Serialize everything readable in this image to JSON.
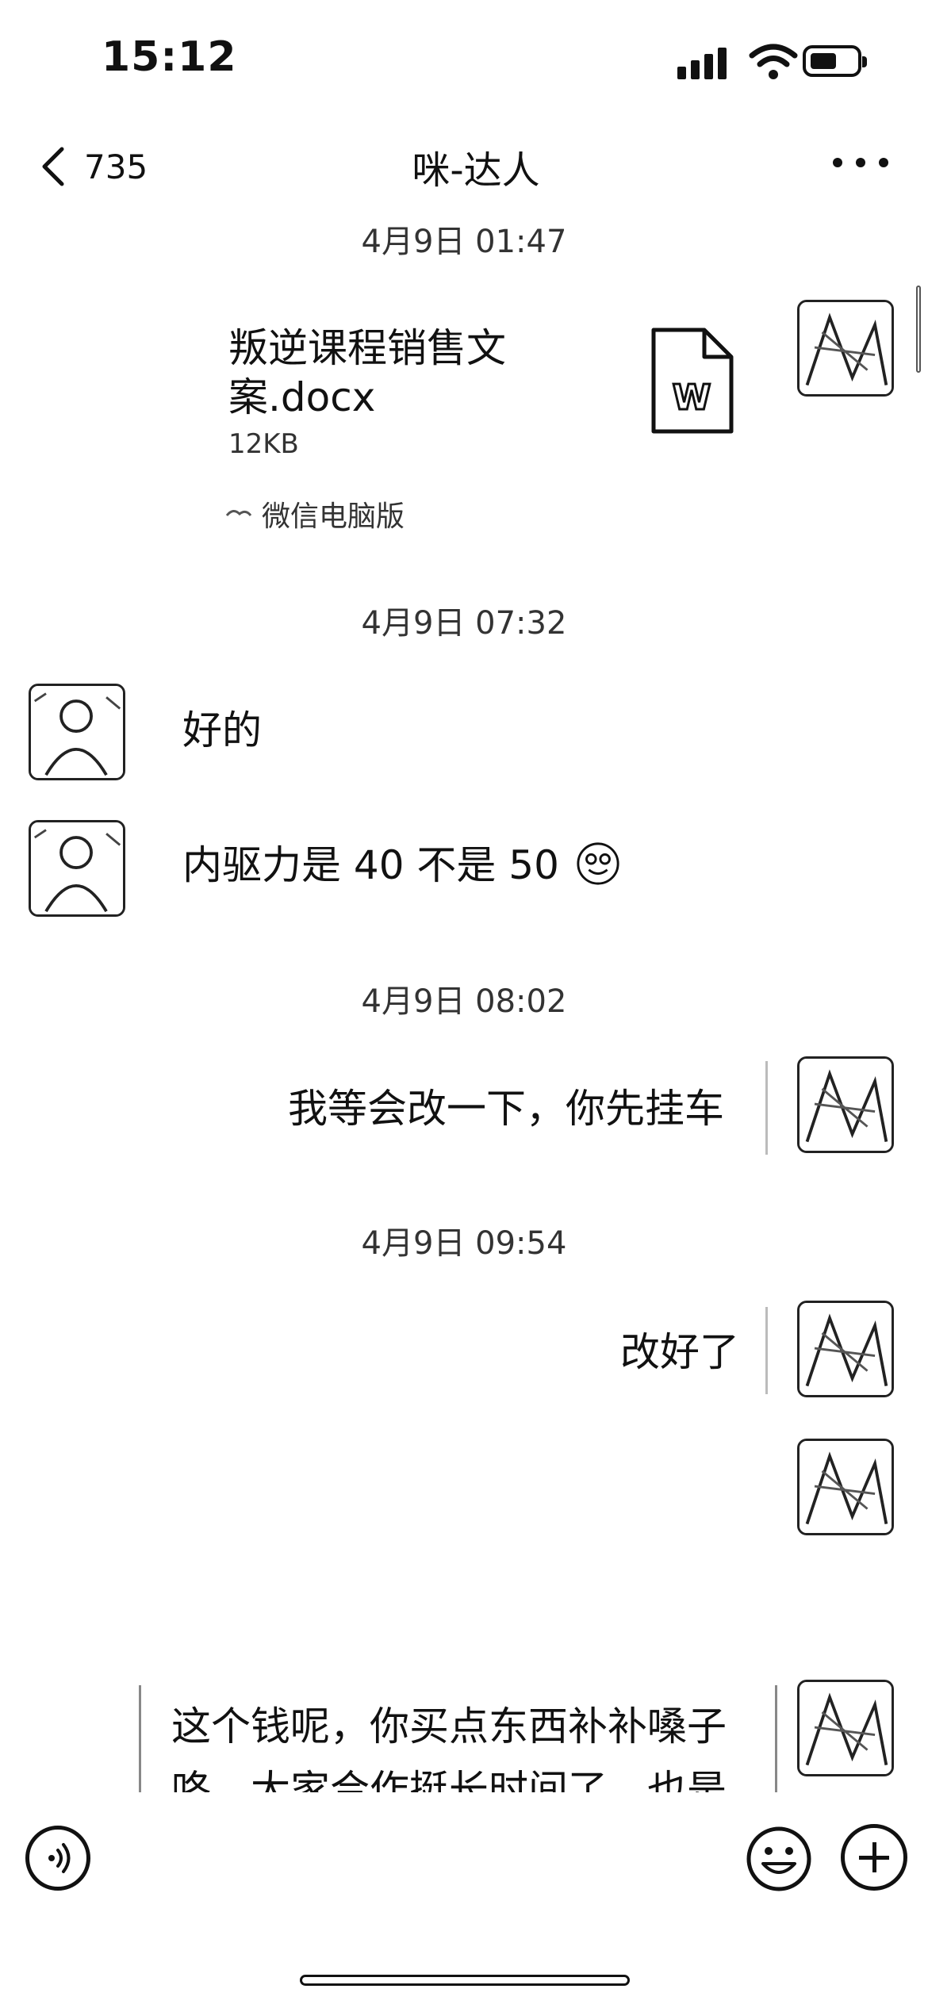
{
  "status_bar": {
    "time": "15:12"
  },
  "nav": {
    "back_count": "735",
    "title": "咪-达人"
  },
  "messages": [
    {
      "timestamp": "4月9日 01:47"
    },
    {
      "file": {
        "name": "叛逆课程销售文案.docx",
        "size": "12KB",
        "source": "微信电脑版",
        "icon": "word-doc-icon"
      }
    },
    {
      "timestamp": "4月9日 07:32"
    },
    {
      "text": "好的"
    },
    {
      "text": "内驱力是 40 不是 50"
    },
    {
      "timestamp": "4月9日 08:02"
    },
    {
      "text": "我等会改一下，你先挂车"
    },
    {
      "timestamp": "4月9日 09:54"
    },
    {
      "text": "改好了"
    },
    {
      "text": "这个钱呢，你买点东西补补嗓子咯，大家合作挺长时间了，也是"
    }
  ],
  "icons": {
    "back": "chevron-left-icon",
    "more": "more-dots-icon",
    "voice": "voice-icon",
    "emoji": "emoji-icon",
    "plus": "plus-icon"
  }
}
